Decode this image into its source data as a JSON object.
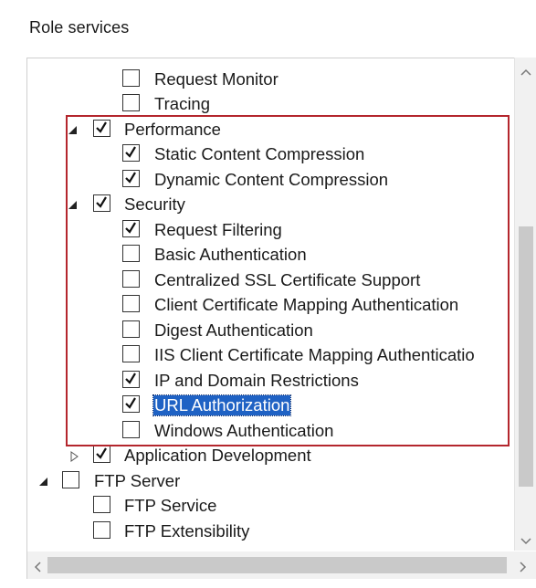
{
  "section": {
    "title": "Role services"
  },
  "tree": {
    "items": [
      {
        "label": "Request Monitor",
        "checked": false,
        "expander": "none"
      },
      {
        "label": "Tracing",
        "checked": false,
        "expander": "none"
      },
      {
        "label": "Performance",
        "checked": true,
        "expander": "expanded"
      },
      {
        "label": "Static Content Compression",
        "checked": true,
        "expander": "none"
      },
      {
        "label": "Dynamic Content Compression",
        "checked": true,
        "expander": "none"
      },
      {
        "label": "Security",
        "checked": true,
        "expander": "expanded"
      },
      {
        "label": "Request Filtering",
        "checked": true,
        "expander": "none"
      },
      {
        "label": "Basic Authentication",
        "checked": false,
        "expander": "none"
      },
      {
        "label": "Centralized SSL Certificate Support",
        "checked": false,
        "expander": "none"
      },
      {
        "label": "Client Certificate Mapping Authentication",
        "checked": false,
        "expander": "none"
      },
      {
        "label": "Digest Authentication",
        "checked": false,
        "expander": "none"
      },
      {
        "label": "IIS Client Certificate Mapping Authenticatio",
        "checked": false,
        "expander": "none"
      },
      {
        "label": "IP and Domain Restrictions",
        "checked": true,
        "expander": "none"
      },
      {
        "label": "URL Authorization",
        "checked": true,
        "expander": "none",
        "selected": true
      },
      {
        "label": "Windows Authentication",
        "checked": false,
        "expander": "none"
      },
      {
        "label": "Application Development",
        "checked": true,
        "expander": "collapsed"
      },
      {
        "label": "FTP Server",
        "checked": false,
        "expander": "expanded"
      },
      {
        "label": "FTP Service",
        "checked": false,
        "expander": "none"
      },
      {
        "label": "FTP Extensibility",
        "checked": false,
        "expander": "none"
      }
    ]
  },
  "colors": {
    "highlight_box": "#b4262d",
    "selection": "#1f62c4"
  },
  "icons": {
    "expanded": "triangle-expanded-icon",
    "collapsed": "triangle-collapsed-icon",
    "check": "checkmark-icon",
    "scroll_up": "chevron-up-icon",
    "scroll_down": "chevron-down-icon",
    "scroll_left": "chevron-left-icon",
    "scroll_right": "chevron-right-icon"
  }
}
